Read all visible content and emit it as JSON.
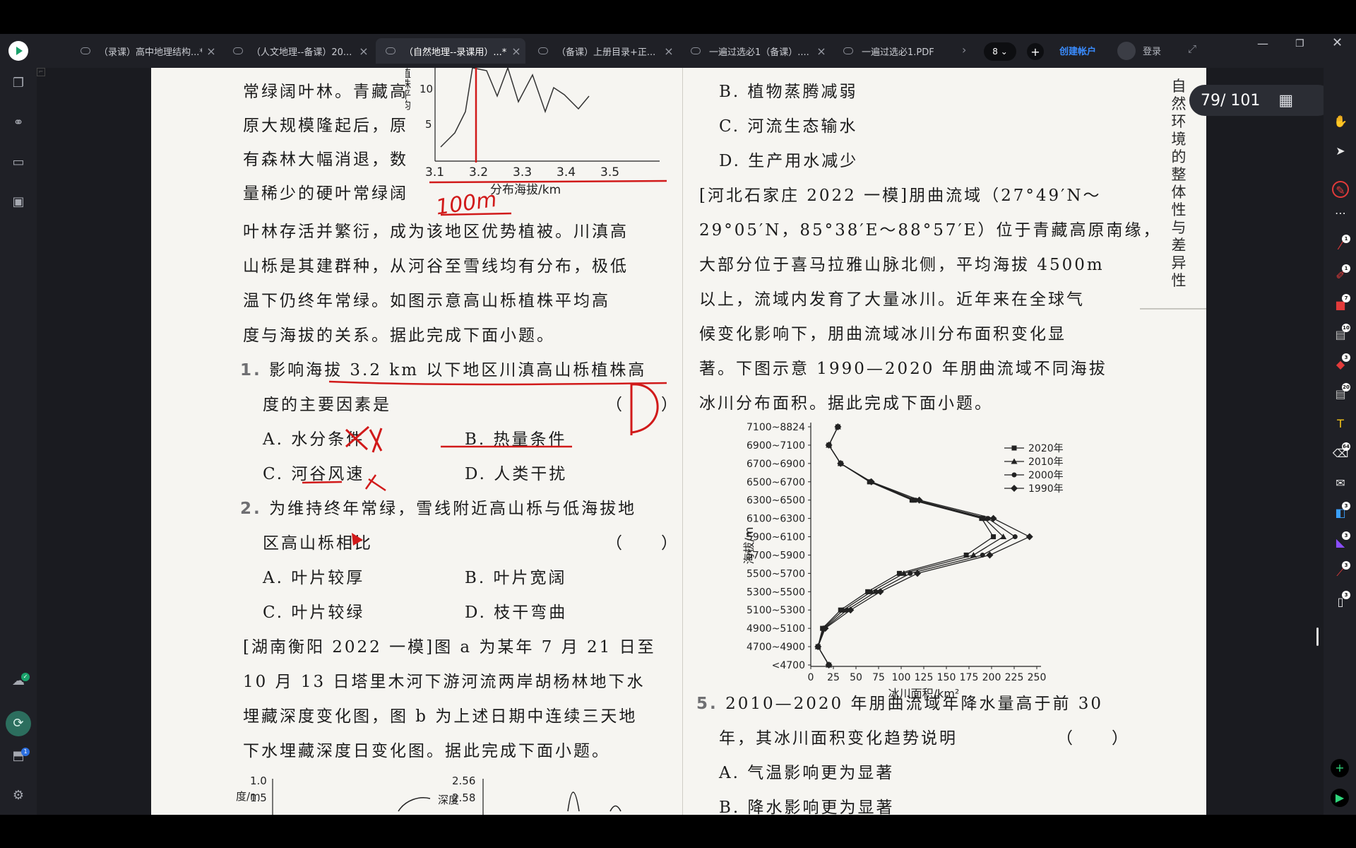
{
  "tabs": [
    {
      "title": "（录课）高中地理结构...*",
      "active": false
    },
    {
      "title": "（人文地理--备课）20...",
      "active": false
    },
    {
      "title": "（自然地理--录课用）...*",
      "active": true
    },
    {
      "title": "（备课）上册目录+正...",
      "active": false
    },
    {
      "title": "一遍过选必1（备课）....",
      "active": false
    },
    {
      "title": "一遍过选必1.PDF",
      "active": false
    }
  ],
  "tab_close_glyph": "×",
  "tab_count": "8",
  "create_account": "创建帐户",
  "login": "登录",
  "page_indicator": "79/ 101",
  "side_heading": "自然环境的整体性与差异性",
  "left_column": {
    "top_chart": {
      "y_label": "植株平均",
      "x_label": "分布海拔/km",
      "x_ticks": [
        "3.1",
        "3.2",
        "3.3",
        "3.4",
        "3.5"
      ],
      "y_ticks": [
        "10",
        "5"
      ],
      "annotation": "100m"
    },
    "intro_lines": [
      "常绿阔叶林。青藏高",
      "原大规模隆起后，原",
      "有森林大幅消退，数",
      "量稀少的硬叶常绿阔",
      "叶林存活并繁衍，成为该地区优势植被。川滇高",
      "山栎是其建群种，从河谷至雪线均有分布，极低",
      "温下仍终年常绿。如图示意高山栎植株平均高",
      "度与海拔的关系。据此完成下面小题。"
    ],
    "q1": {
      "num": "1.",
      "line1": "影响海拔 3.2 km 以下地区川滇高山栎植株高",
      "line2": "度的主要因素是",
      "paren": "（　　）",
      "options": [
        "A. 水分条件",
        "B. 热量条件",
        "C. 河谷风速",
        "D. 人类干扰"
      ],
      "handwritten_answer": "D"
    },
    "q2": {
      "num": "2.",
      "line1": "为维持终年常绿，雪线附近高山栎与低海拔地",
      "line2": "区高山栎相比",
      "paren": "（　　）",
      "options": [
        "A. 叶片较厚",
        "B. 叶片宽阔",
        "C. 叶片较绿",
        "D. 枝干弯曲"
      ]
    },
    "passage2_lines": [
      "[湖南衡阳 2022 一模]图 a 为某年 7 月 21 日至",
      "10 月 13 日塔里木河下游河流两岸胡杨林地下水",
      "埋藏深度变化图，图 b 为上述日期中连续三天地",
      "下水埋藏深度日变化图。据此完成下面小题。"
    ],
    "bottom_charts": {
      "a_label": "度/m",
      "a_ticks": [
        "1.0",
        "1.5"
      ],
      "b_label": "深度",
      "b_ticks": [
        "2.56",
        "2.58"
      ]
    }
  },
  "right_column": {
    "options_top": [
      "B. 植物蒸腾减弱",
      "C. 河流生态输水",
      "D. 生产用水减少"
    ],
    "passage_lines": [
      "[河北石家庄 2022 一模]朋曲流域（27°49′N～",
      "29°05′N，85°38′E～88°57′E）位于青藏高原南缘，",
      "大部分位于喜马拉雅山脉北侧，平均海拔 4500m",
      "以上，流域内发育了大量冰川。近年来在全球气",
      "候变化影响下，朋曲流域冰川分布面积变化显",
      "著。下图示意 1990—2020 年朋曲流域不同海拔",
      "冰川分布面积。据此完成下面小题。"
    ],
    "q5": {
      "num": "5.",
      "line1": "2010—2020 年朋曲流域年降水量高于前 30",
      "line2": "年，其冰川面积变化趋势说明",
      "paren": "（　　）",
      "options": [
        "A. 气温影响更为显著",
        "B. 降水影响更为显著"
      ]
    }
  },
  "chart_data": {
    "type": "line",
    "title": "",
    "xlabel": "冰川面积/km²",
    "ylabel": "海拔/m",
    "xlim": [
      0,
      250
    ],
    "x_ticks": [
      "0",
      "25",
      "50",
      "75",
      "100",
      "125",
      "150",
      "175",
      "200",
      "225",
      "250"
    ],
    "categories": [
      "<4700",
      "4700~4900",
      "4900~5100",
      "5100~5300",
      "5300~5500",
      "5500~5700",
      "5700~5900",
      "5900~6100",
      "6100~6300",
      "6300~6500",
      "6500~6700",
      "6700~6900",
      "6900~7100",
      "7100~8824"
    ],
    "series": [
      {
        "name": "2020年",
        "marker": "square",
        "values": [
          20,
          8,
          13,
          33,
          63,
          98,
          172,
          202,
          189,
          112,
          65,
          33,
          20,
          30
        ]
      },
      {
        "name": "2010年",
        "marker": "triangle",
        "values": [
          20,
          8,
          14,
          36,
          67,
          103,
          180,
          213,
          192,
          114,
          66,
          33,
          20,
          30
        ]
      },
      {
        "name": "2000年",
        "marker": "circle",
        "values": [
          20,
          8,
          15,
          40,
          72,
          110,
          190,
          226,
          196,
          116,
          66,
          33,
          20,
          30
        ]
      },
      {
        "name": "1990年",
        "marker": "diamond",
        "values": [
          20,
          8,
          16,
          44,
          77,
          118,
          198,
          242,
          202,
          120,
          67,
          33,
          20,
          30
        ]
      }
    ]
  }
}
